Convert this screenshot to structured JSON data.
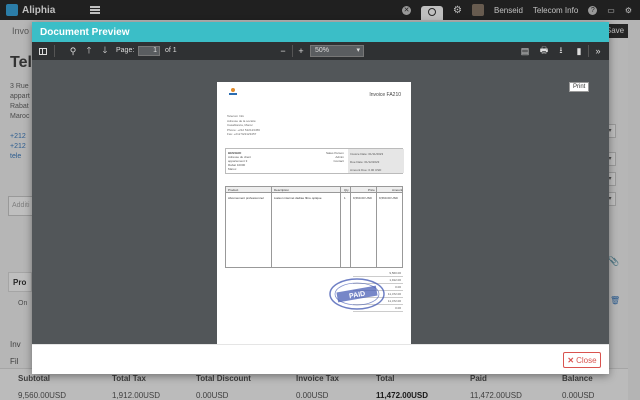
{
  "app": {
    "brand": "Aliphia",
    "user_name": "Benseid",
    "company": "Telecom Info"
  },
  "background": {
    "tab_label": "Invo",
    "heading": "Tele",
    "save_label": "Save",
    "address": [
      "3 Rue",
      "appart",
      "Rabat",
      "Maroc"
    ],
    "contacts": [
      "+212",
      "+212",
      "tele"
    ],
    "add_placeholder": "Additi",
    "section_label": "Pro",
    "row_text": "On",
    "link1": "Inv",
    "link2": "Fil",
    "right_sel": "▾",
    "totals": [
      {
        "label": "Subtotal",
        "value": "9,560.00USD"
      },
      {
        "label": "Total Tax",
        "value": "1,912.00USD"
      },
      {
        "label": "Total Discount",
        "value": "0.00USD"
      },
      {
        "label": "Invoice Tax",
        "value": "0.00USD"
      },
      {
        "label": "Total",
        "value": "11,472.00USD"
      },
      {
        "label": "Paid",
        "value": "11,472.00USD"
      },
      {
        "label": "Balance",
        "value": "0.00USD"
      }
    ]
  },
  "modal": {
    "title": "Document Preview",
    "close_label": "Close",
    "toolbar": {
      "page_label": "Page:",
      "page_value": "1",
      "page_total": "of 1",
      "zoom": "50%",
      "tooltip": "Print"
    }
  },
  "pdf": {
    "invoice_no": "Invoice FA210",
    "sender": [
      "Telecom Info",
      "Adresse de la société",
      "Casablanca, Maroc",
      "Phone: +212 522123456",
      "Fax: +212 522123457"
    ],
    "client": [
      "BENSEID",
      "Adresse du client",
      "appartement 3",
      "Rabat 10000",
      "Maroc",
      "Phone: +212 600000000"
    ],
    "box_mid": [
      "Sales Person",
      "Admin",
      "Contact",
      ""
    ],
    "box_right": [
      "Invoice Date: 01/11/2023",
      "Due Date: 01/12/2023",
      "Amount Due: 0.00 USD"
    ],
    "columns": [
      "Product",
      "Description",
      "Qty",
      "Price",
      "Amount"
    ],
    "rows": [
      [
        "Abonnement professionnel",
        "Liaison internet dédiée fibre optique",
        "1",
        "9,560.00 USD",
        "9,560.00 USD"
      ]
    ],
    "totals": [
      "9,560.00",
      "1,912.00",
      "0.00",
      "11,472.00",
      "11,472.00",
      "0.00"
    ],
    "stamp_text": "PAID",
    "footer": "Telecom Info"
  },
  "colors": {
    "header_accent": "#3bbec7",
    "close_red": "#d9534f",
    "stamp_blue": "#4a5fb5"
  }
}
